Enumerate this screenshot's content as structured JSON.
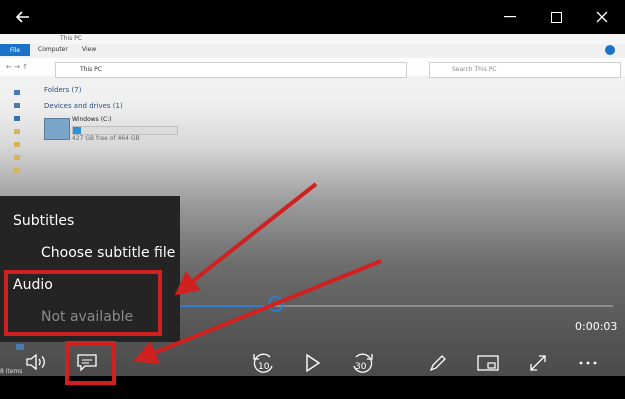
{
  "window": {
    "back_icon": "back-arrow-icon"
  },
  "explorer": {
    "title": "This PC",
    "ribbon_tabs": [
      "File",
      "Computer",
      "View"
    ],
    "address": "This PC",
    "search_placeholder": "Search This PC",
    "folders_group": "Folders (7)",
    "devices_group": "Devices and drives (1)",
    "drive_name": "Windows (C:)",
    "drive_free": "427 GB free of 464 GB",
    "drive_used_fraction": 0.08,
    "items_count": "8 items"
  },
  "player": {
    "progress_fraction": 0.45,
    "time": "0:00:03",
    "skip_back": "10",
    "skip_forward": "30"
  },
  "menu": {
    "subtitles_header": "Subtitles",
    "choose_subtitle": "Choose subtitle file",
    "audio_header": "Audio",
    "audio_status": "Not available"
  },
  "colors": {
    "annotation_red": "#d02020",
    "accent_blue": "#2e7fd1"
  }
}
